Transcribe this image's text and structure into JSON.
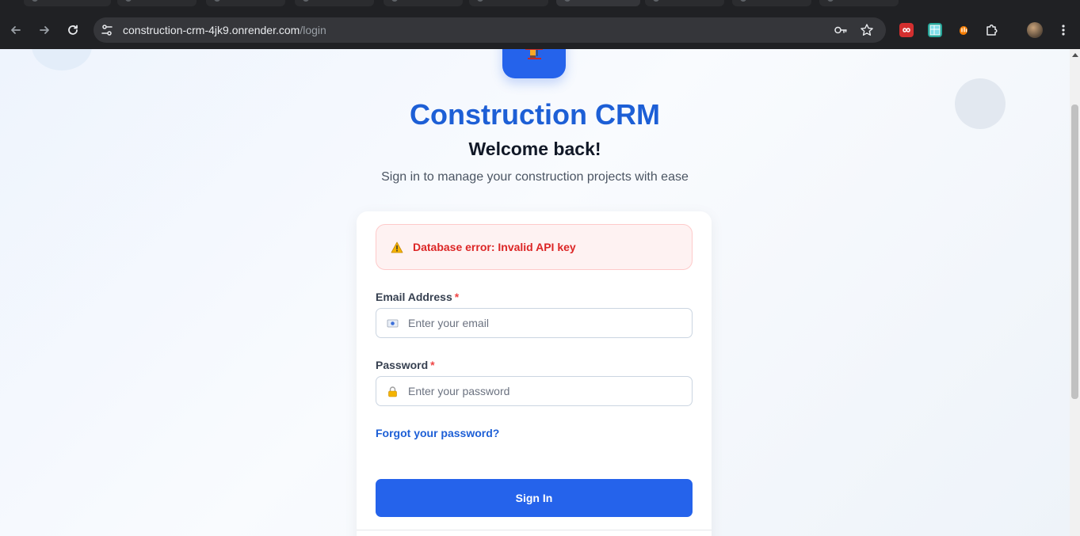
{
  "browser": {
    "url_host": "construction-crm-4jk9.onrender.com",
    "url_path": "/login",
    "icons": {
      "back": "arrow-left-icon",
      "forward": "arrow-right-icon",
      "reload": "reload-icon",
      "site_info": "tune-icon",
      "password": "key-icon",
      "bookmark": "star-icon",
      "extensions": "puzzle-icon",
      "menu": "kebab-menu-icon"
    }
  },
  "app": {
    "title": "Construction CRM",
    "subtitle": "Welcome back!",
    "tagline": "Sign in to manage your construction projects with ease"
  },
  "alert": {
    "message": "Database error: Invalid API key",
    "icon": "warning-icon"
  },
  "form": {
    "email": {
      "label": "Email Address",
      "required_mark": "*",
      "placeholder": "Enter your email",
      "value": "",
      "icon": "email-icon"
    },
    "password": {
      "label": "Password",
      "required_mark": "*",
      "placeholder": "Enter your password",
      "value": "",
      "icon": "lock-icon"
    },
    "forgot_link": "Forgot your password?",
    "submit_label": "Sign In"
  },
  "colors": {
    "primary": "#2563eb",
    "title": "#1d5fd6",
    "error_text": "#dc2626",
    "error_bg": "#fef2f2",
    "required": "#ef4444"
  }
}
